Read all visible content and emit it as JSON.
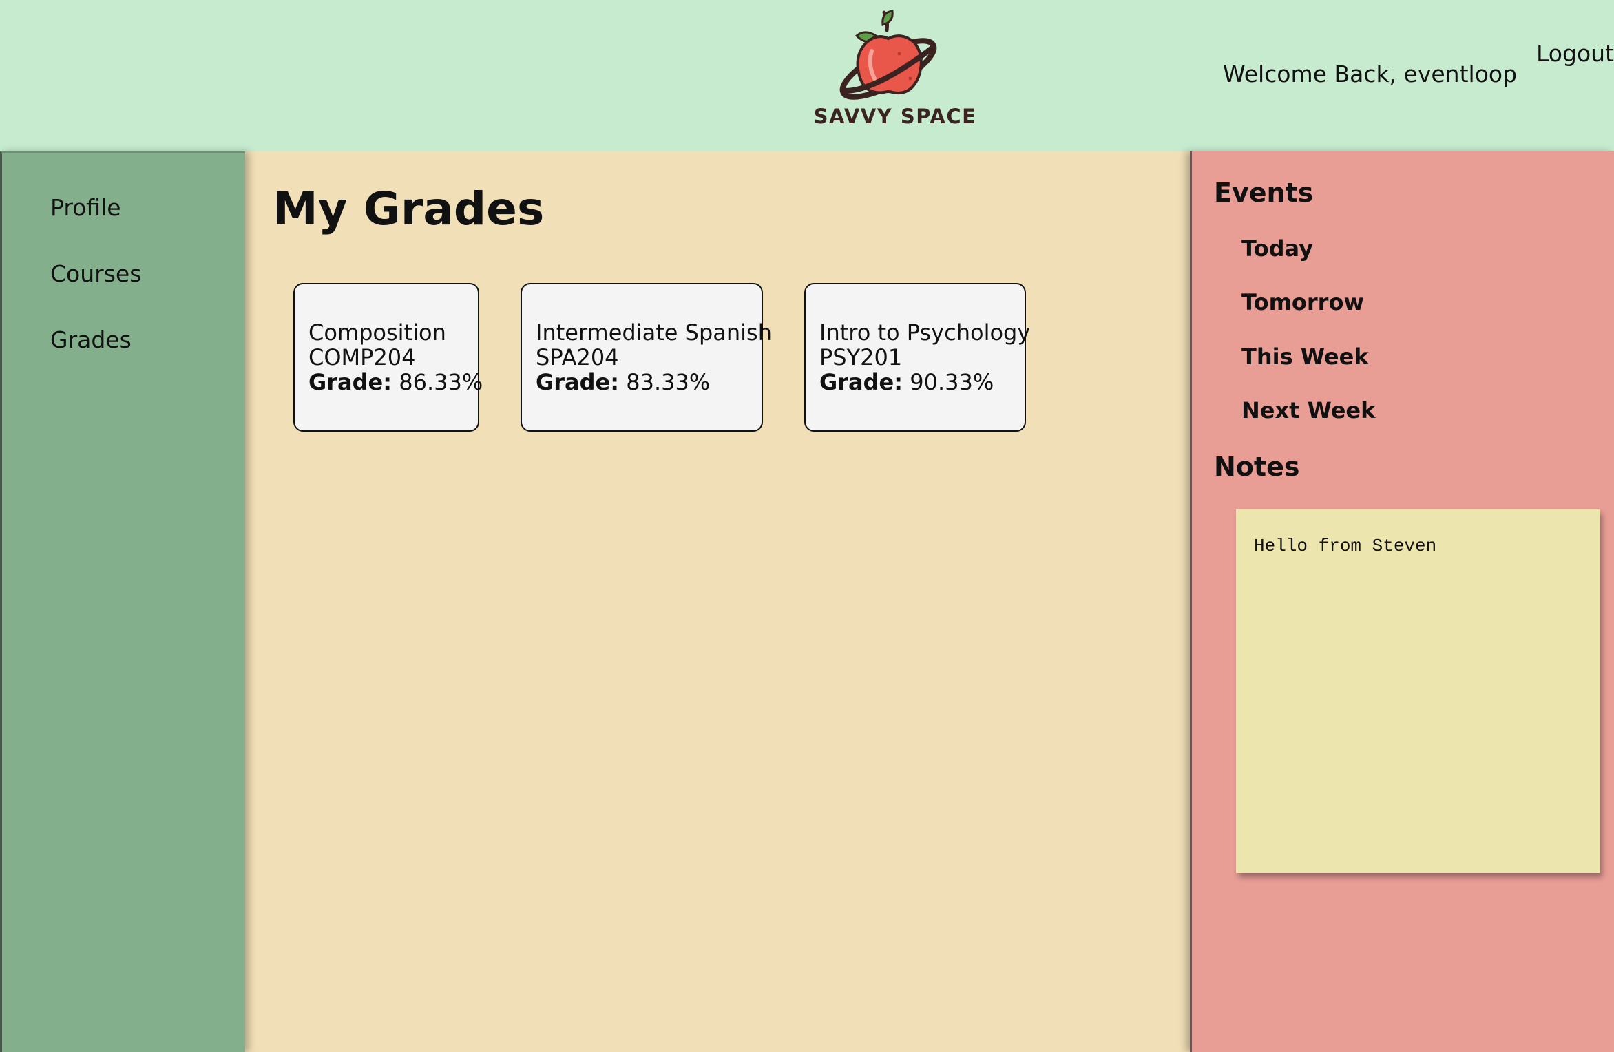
{
  "header": {
    "logo_text": "SAVVY SPACE",
    "welcome": "Welcome Back, eventloop",
    "logout_label": "Logout"
  },
  "sidebar": {
    "items": [
      {
        "label": "Profile"
      },
      {
        "label": "Courses"
      },
      {
        "label": "Grades"
      }
    ]
  },
  "main": {
    "title": "My Grades",
    "grade_label": "Grade:",
    "courses": [
      {
        "name": "Composition",
        "code": "COMP204",
        "grade": "86.33%"
      },
      {
        "name": "Intermediate Spanish",
        "code": "SPA204",
        "grade": "83.33%"
      },
      {
        "name": "Intro to Psychology",
        "code": "PSY201",
        "grade": "90.33%"
      }
    ]
  },
  "rightpanel": {
    "events_heading": "Events",
    "events": [
      {
        "label": "Today"
      },
      {
        "label": "Tomorrow"
      },
      {
        "label": "This Week"
      },
      {
        "label": "Next Week"
      }
    ],
    "notes_heading": "Notes",
    "note_text": "Hello from Steven"
  },
  "colors": {
    "header_bg": "#c6ebcf",
    "sidebar_bg": "#84af8c",
    "main_bg": "#f1dfb7",
    "rightpanel_bg": "#e89e95",
    "note_bg": "#ece5ae",
    "card_bg": "#f4f4f4"
  },
  "icons": {
    "logo": "apple-planet-logo-icon"
  }
}
